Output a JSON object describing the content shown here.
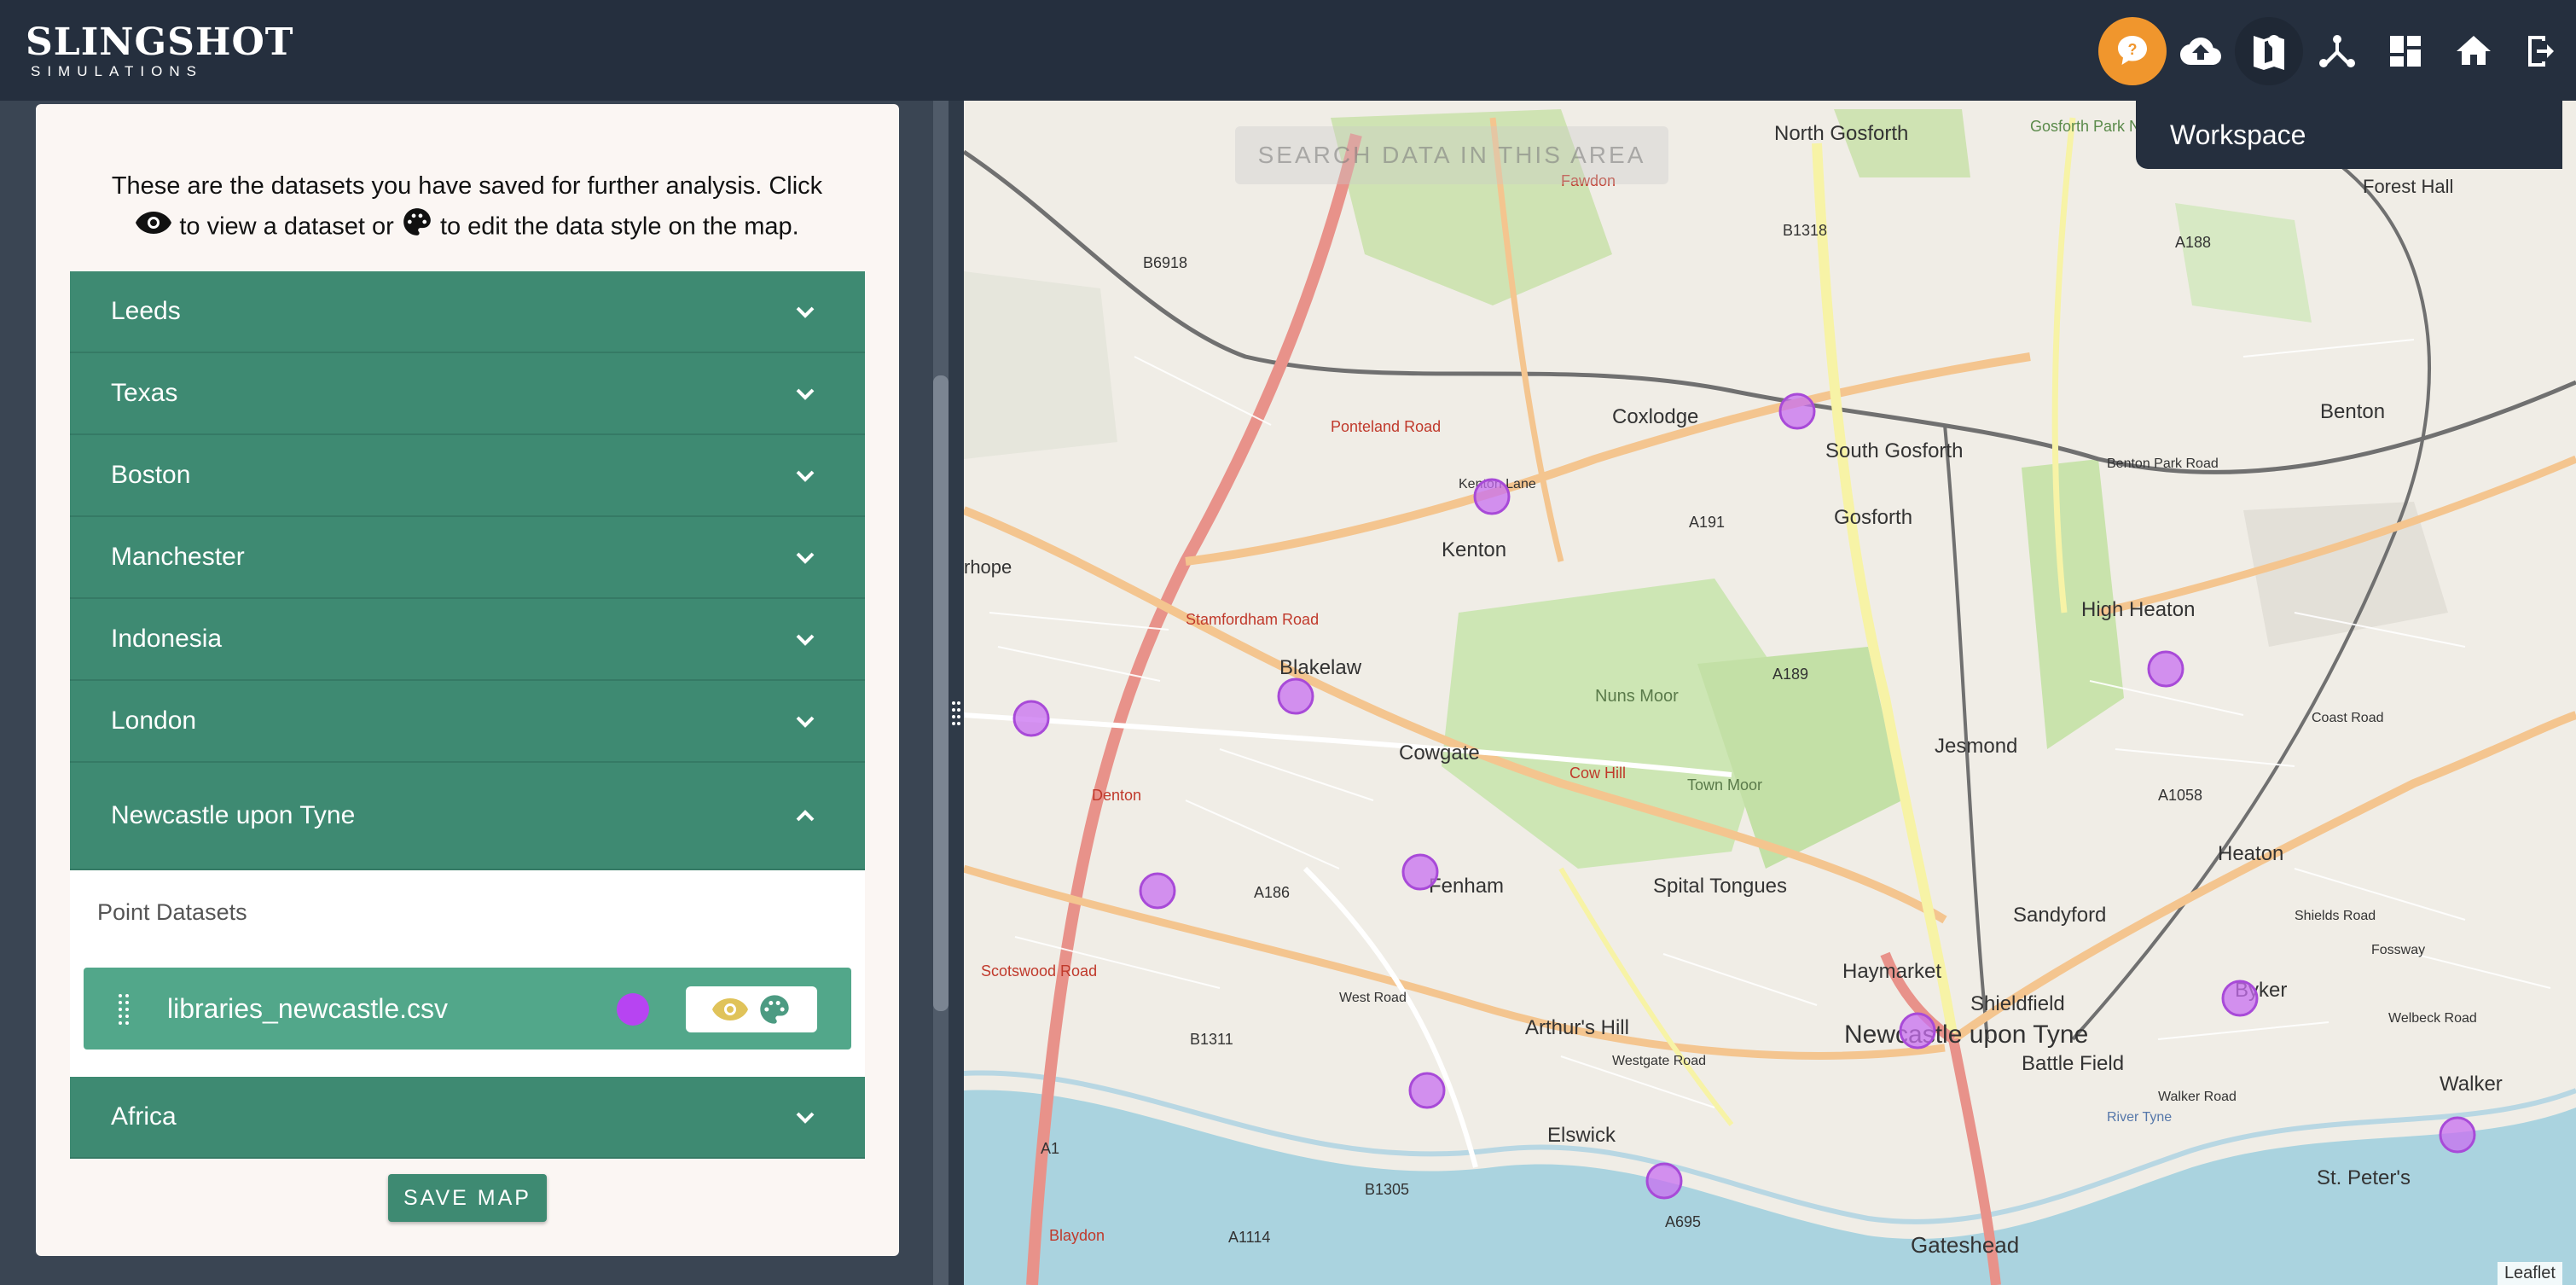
{
  "app": {
    "logo_main": "SLINGSHOT",
    "logo_sub": "SIMULATIONS"
  },
  "toolbar": {
    "icons": [
      "help-chat-icon",
      "cloud-upload-icon",
      "map-icon",
      "network-icon",
      "dashboard-icon",
      "home-icon",
      "logout-icon"
    ],
    "workspace_tooltip": "Workspace",
    "accent_color": "#f0962d"
  },
  "panel": {
    "intro_part1": "These are the datasets you have saved for further analysis. Click",
    "intro_part2": "to view a dataset or",
    "intro_part3": "to edit the data style on the map.",
    "groups": [
      {
        "label": "Leeds"
      },
      {
        "label": "Texas"
      },
      {
        "label": "Boston"
      },
      {
        "label": "Manchester"
      },
      {
        "label": "Indonesia"
      },
      {
        "label": "London"
      },
      {
        "label": "Newcastle upon Tyne"
      },
      {
        "label": "Africa"
      }
    ],
    "expanded": {
      "section_label": "Point Datasets",
      "dataset_name": "libraries_newcastle.csv",
      "dataset_color": "#b744f2"
    },
    "save_label": "SAVE MAP",
    "accent_color": "#3e8a72"
  },
  "map": {
    "search_label": "SEARCH DATA IN THIS AREA",
    "attribution": "Leaflet",
    "places": [
      "North Gosforth",
      "Gosforth Park Nature Reserve",
      "Forest Hall",
      "Fawdon",
      "B6918",
      "B1318",
      "A188",
      "A191",
      "Coxlodge",
      "South Gosforth",
      "Benton",
      "Ponteland Road",
      "Kenton Lane",
      "Kenton",
      "Gosforth",
      "Benton Park Road",
      "rhope",
      "Stamfordham Road",
      "Blakelaw",
      "A189",
      "High Heaton",
      "Nuns Moor",
      "Cowgate",
      "Cow Hill",
      "Town Moor",
      "Jesmond",
      "A1058",
      "Denton",
      "Fenham",
      "Spital Tongues",
      "Heaton",
      "Sandyford",
      "A186",
      "Scotswood Road",
      "West Road",
      "Haymarket",
      "Shieldfield",
      "Byker",
      "Arthur's Hill",
      "Newcastle upon Tyne",
      "B1311",
      "Battle Field",
      "Westgate Road",
      "Walker",
      "Elswick",
      "A1",
      "B1305",
      "A695",
      "St. Peter's",
      "Blaydon",
      "A1114",
      "Gateshead",
      "Coast Road",
      "Shields Road",
      "Fossway",
      "Walker Road",
      "Welbeck Road",
      "River Tyne"
    ]
  }
}
